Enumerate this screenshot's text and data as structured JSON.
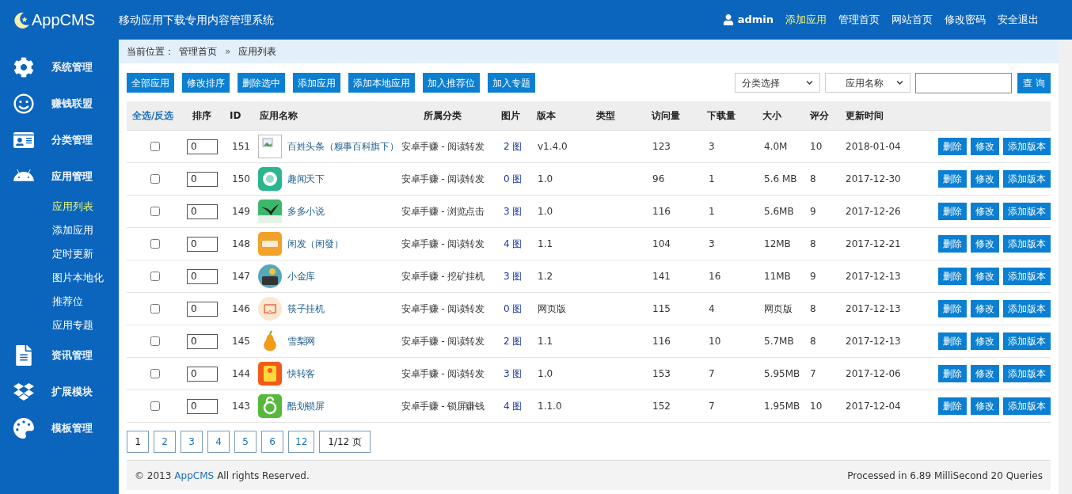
{
  "header": {
    "logo": "AppCMS",
    "subtitle": "移动应用下载专用内容管理系统",
    "user": "admin",
    "links": [
      {
        "label": "添加应用",
        "selected": true
      },
      {
        "label": "管理首页",
        "selected": false
      },
      {
        "label": "网站首页",
        "selected": false
      },
      {
        "label": "修改密码",
        "selected": false
      },
      {
        "label": "安全退出",
        "selected": false
      }
    ]
  },
  "sidebar": {
    "items": [
      {
        "label": "系统管理",
        "expanded": false
      },
      {
        "label": "赚钱联盟",
        "expanded": false
      },
      {
        "label": "分类管理",
        "expanded": false
      },
      {
        "label": "应用管理",
        "expanded": true,
        "children": [
          {
            "label": "应用列表",
            "selected": true
          },
          {
            "label": "添加应用",
            "selected": false
          },
          {
            "label": "定时更新",
            "selected": false
          },
          {
            "label": "图片本地化",
            "selected": false
          },
          {
            "label": "推荐位",
            "selected": false
          },
          {
            "label": "应用专题",
            "selected": false
          }
        ]
      },
      {
        "label": "资讯管理",
        "expanded": false
      },
      {
        "label": "扩展模块",
        "expanded": false
      },
      {
        "label": "模板管理",
        "expanded": false
      }
    ]
  },
  "breadcrumb": {
    "label": "当前位置：",
    "items": [
      "管理首页",
      "应用列表"
    ],
    "separator": "»"
  },
  "toolbar": {
    "buttons": [
      "全部应用",
      "修改排序",
      "删除选中",
      "添加应用",
      "添加本地应用",
      "加入推荐位",
      "加入专题"
    ],
    "category_select": "分类选择",
    "field_select": "应用名称",
    "search_button": "查 询"
  },
  "table": {
    "columns": [
      "全选/反选",
      "排序",
      "ID",
      "应用名称",
      "所属分类",
      "图片",
      "版本",
      "类型",
      "访问量",
      "下载量",
      "大小",
      "评分",
      "更新时间"
    ],
    "rows": [
      {
        "checked": false,
        "sort": "0",
        "id": "151",
        "name": "百姓头条（糗事百科旗下）",
        "category": "安卓手赚 - 阅读转发",
        "pics": "2 图",
        "version": "v1.4.0",
        "visits": "123",
        "downloads": "3",
        "size": "4.0M",
        "rating": "10",
        "updated": "2018-01-04",
        "actions": [
          "删除",
          "修改",
          "添加版本"
        ]
      },
      {
        "checked": false,
        "sort": "0",
        "id": "150",
        "name": "趣闻天下",
        "category": "安卓手赚 - 阅读转发",
        "pics": "0 图",
        "version": "1.0",
        "visits": "96",
        "downloads": "1",
        "size": "5.6 MB",
        "rating": "8",
        "updated": "2017-12-30",
        "actions": [
          "删除",
          "修改",
          "添加版本"
        ]
      },
      {
        "checked": false,
        "sort": "0",
        "id": "149",
        "name": "多多小说",
        "category": "安卓手赚 - 浏览点击",
        "pics": "3 图",
        "version": "1.0",
        "visits": "116",
        "downloads": "1",
        "size": "5.6MB",
        "rating": "9",
        "updated": "2017-12-26",
        "actions": [
          "删除",
          "修改",
          "添加版本"
        ]
      },
      {
        "checked": false,
        "sort": "0",
        "id": "148",
        "name": "闲发（闲發）",
        "category": "安卓手赚 - 阅读转发",
        "pics": "4 图",
        "version": "1.1",
        "visits": "104",
        "downloads": "3",
        "size": "12MB",
        "rating": "8",
        "updated": "2017-12-21",
        "actions": [
          "删除",
          "修改",
          "添加版本"
        ]
      },
      {
        "checked": false,
        "sort": "0",
        "id": "147",
        "name": "小金库",
        "category": "安卓手赚 - 挖矿挂机",
        "pics": "3 图",
        "version": "1.2",
        "visits": "141",
        "downloads": "16",
        "size": "11MB",
        "rating": "9",
        "updated": "2017-12-13",
        "actions": [
          "删除",
          "修改",
          "添加版本"
        ]
      },
      {
        "checked": false,
        "sort": "0",
        "id": "146",
        "name": "筷子挂机",
        "category": "安卓手赚 - 阅读转发",
        "pics": "0 图",
        "version": "网页版",
        "visits": "115",
        "downloads": "4",
        "size": "网页版",
        "rating": "8",
        "updated": "2017-12-13",
        "actions": [
          "删除",
          "修改",
          "添加版本"
        ]
      },
      {
        "checked": false,
        "sort": "0",
        "id": "145",
        "name": "雪梨网",
        "category": "安卓手赚 - 阅读转发",
        "pics": "2 图",
        "version": "1.1",
        "visits": "116",
        "downloads": "10",
        "size": "5.7MB",
        "rating": "8",
        "updated": "2017-12-13",
        "actions": [
          "删除",
          "修改",
          "添加版本"
        ]
      },
      {
        "checked": false,
        "sort": "0",
        "id": "144",
        "name": "快转客",
        "category": "安卓手赚 - 阅读转发",
        "pics": "3 图",
        "version": "1.0",
        "visits": "153",
        "downloads": "7",
        "size": "5.95MB",
        "rating": "7",
        "updated": "2017-12-06",
        "actions": [
          "删除",
          "修改",
          "添加版本"
        ]
      },
      {
        "checked": false,
        "sort": "0",
        "id": "143",
        "name": "酷划锁屏",
        "category": "安卓手赚 - 锁屏赚钱",
        "pics": "4 图",
        "version": "1.1.0",
        "visits": "152",
        "downloads": "7",
        "size": "1.95MB",
        "rating": "10",
        "updated": "2017-12-04",
        "actions": [
          "删除",
          "修改",
          "添加版本"
        ]
      }
    ]
  },
  "pagination": {
    "pages": [
      {
        "label": "1",
        "selected": true
      },
      {
        "label": "2",
        "selected": false
      },
      {
        "label": "3",
        "selected": false
      },
      {
        "label": "4",
        "selected": false
      },
      {
        "label": "5",
        "selected": false
      },
      {
        "label": "6",
        "selected": false
      },
      {
        "label": "12",
        "selected": false
      }
    ],
    "summary": "1/12 页"
  },
  "footer": {
    "copyright": "© 2013",
    "brand": "AppCMS",
    "rights": "All rights Reserved.",
    "stats": "Processed in 6.89 MilliSecond 20 Queries"
  }
}
